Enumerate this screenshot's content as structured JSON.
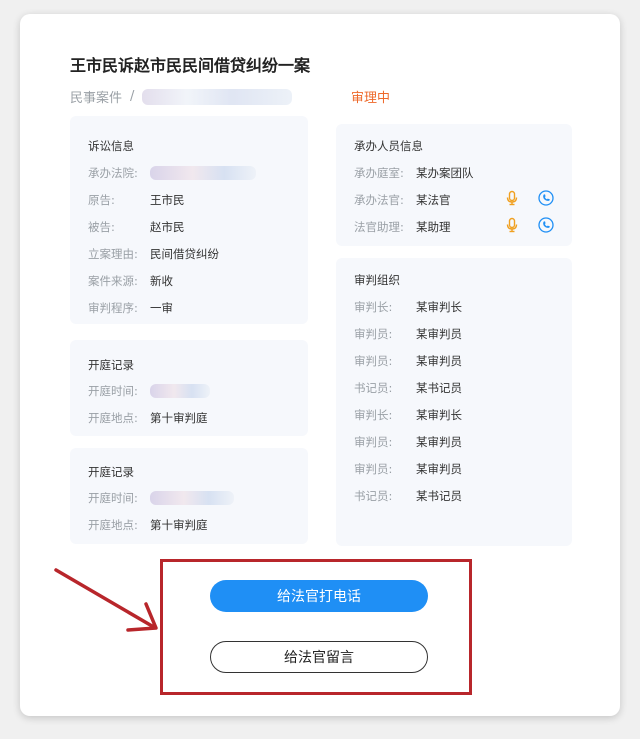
{
  "case": {
    "title": "王市民诉赵市民民间借贷纠纷一案",
    "type": "民事案件",
    "separator": "/",
    "status": "审理中"
  },
  "litigation": {
    "title": "诉讼信息",
    "court_label": "承办法院:",
    "plaintiff_label": "原告:",
    "plaintiff": "王市民",
    "defendant_label": "被告:",
    "defendant": "赵市民",
    "reason_label": "立案理由:",
    "reason": "民间借贷纠纷",
    "source_label": "案件来源:",
    "source": "新收",
    "procedure_label": "审判程序:",
    "procedure": "一审"
  },
  "hearings": [
    {
      "title": "开庭记录",
      "time_label": "开庭时间:",
      "place_label": "开庭地点:",
      "place": "第十审判庭"
    },
    {
      "title": "开庭记录",
      "time_label": "开庭时间:",
      "place_label": "开庭地点:",
      "place": "第十审判庭"
    }
  ],
  "staff": {
    "title": "承办人员信息",
    "rows": [
      {
        "label": "承办庭室:",
        "value": "某办案团队"
      },
      {
        "label": "承办法官:",
        "value": "某法官"
      },
      {
        "label": "法官助理:",
        "value": "某助理"
      }
    ]
  },
  "panel": {
    "title": "审判组织",
    "rows": [
      {
        "label": "审判长:",
        "value": "某审判长"
      },
      {
        "label": "审判员:",
        "value": "某审判员"
      },
      {
        "label": "审判员:",
        "value": "某审判员"
      },
      {
        "label": "书记员:",
        "value": "某书记员"
      },
      {
        "label": "审判长:",
        "value": "某审判长"
      },
      {
        "label": "审判员:",
        "value": "某审判员"
      },
      {
        "label": "审判员:",
        "value": "某审判员"
      },
      {
        "label": "书记员:",
        "value": "某书记员"
      }
    ]
  },
  "actions": {
    "call_label": "给法官打电话",
    "message_label": "给法官留言"
  },
  "colors": {
    "accent": "#1f8ff5",
    "status": "#ee6a2b",
    "highlight": "#b8262b",
    "mic_icon": "#f0a020"
  }
}
